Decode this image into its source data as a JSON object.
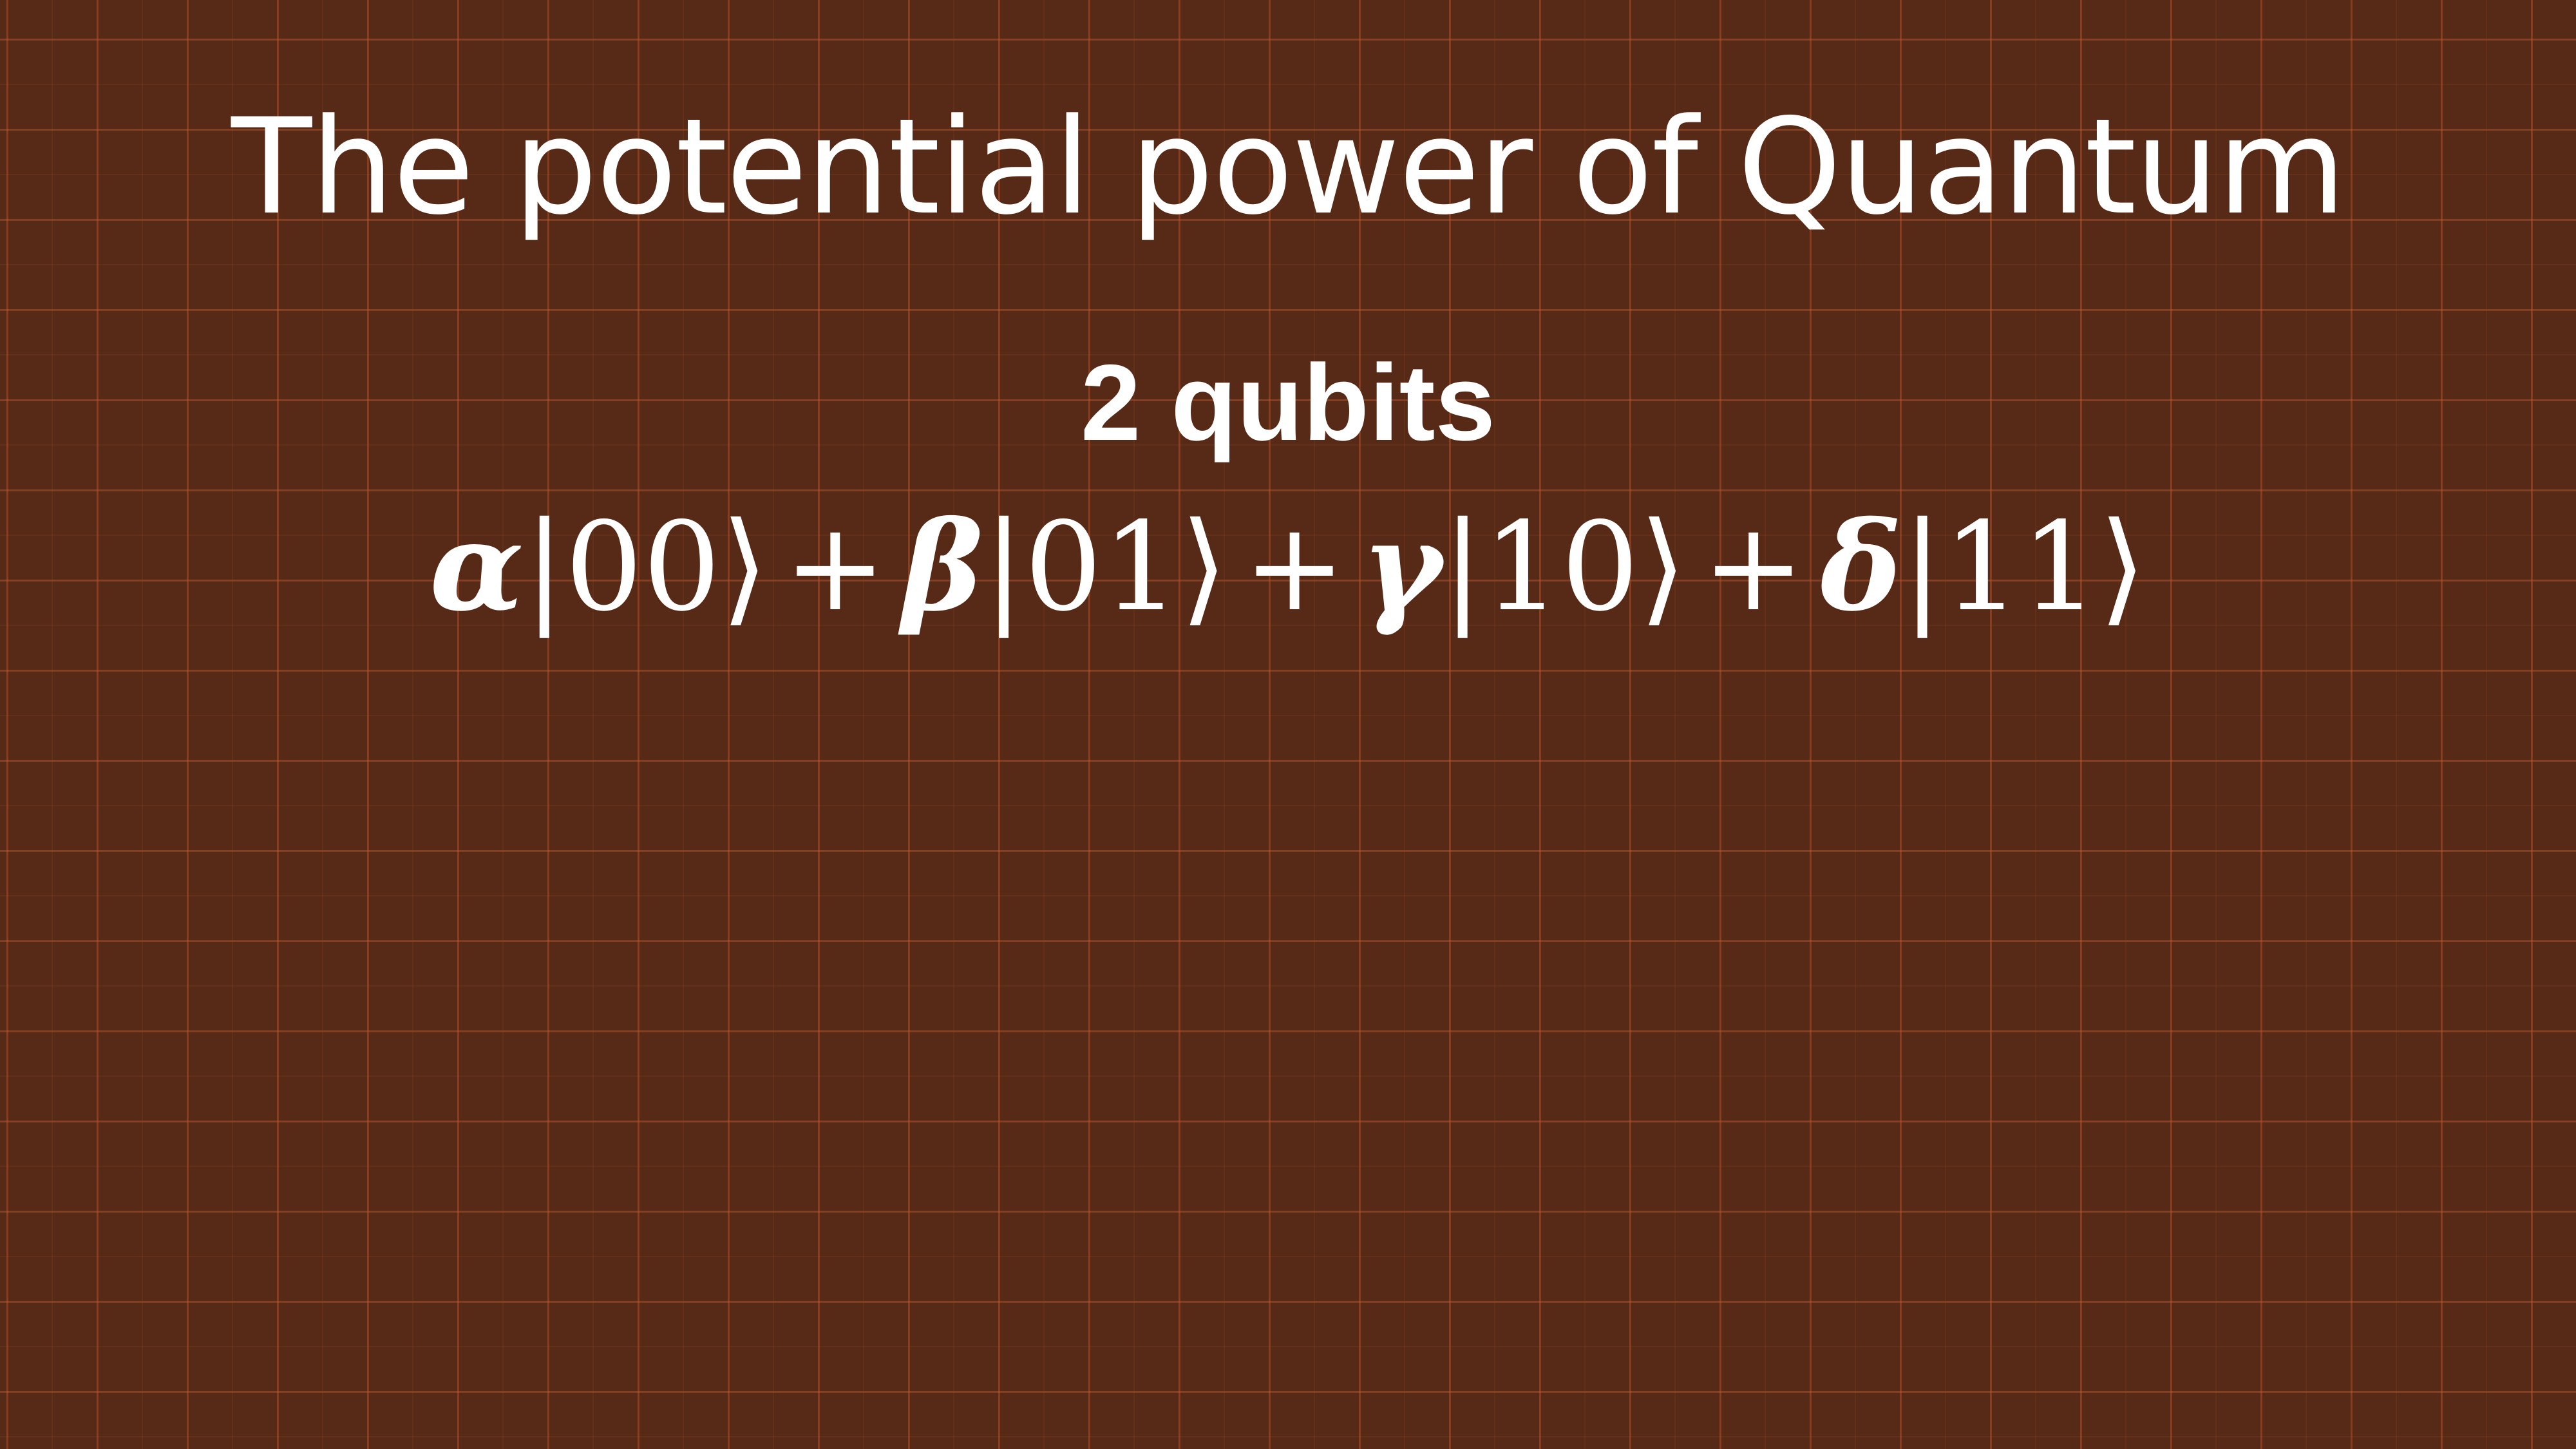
{
  "slide": {
    "title": "The potential power of Quantum",
    "subtitle": "2 qubits",
    "equation": {
      "terms": [
        {
          "coefficient": "α",
          "ket": "|00⟩"
        },
        {
          "coefficient": "β",
          "ket": "|01⟩"
        },
        {
          "coefficient": "γ",
          "ket": "|10⟩"
        },
        {
          "coefficient": "δ",
          "ket": "|11⟩"
        }
      ],
      "operator": "+"
    }
  },
  "colors": {
    "background": "#562a16",
    "grid": "#be5a32",
    "text": "#ffffff"
  }
}
